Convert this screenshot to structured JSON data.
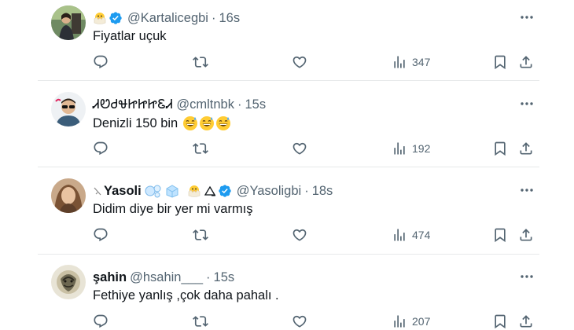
{
  "tweets": [
    {
      "name": "",
      "name_emojis": [
        "hatching-chick-icon"
      ],
      "handle": "@Kartalicegbi",
      "time": "16s",
      "verified": true,
      "text": "Fiyatlar uçuk",
      "text_emojis": [],
      "views": "347"
    },
    {
      "name": "ᏗᏬᏧᏠᏥᏥᏥᏋᏗ",
      "name_emojis": [],
      "handle": "@cmltnbk",
      "time": "15s",
      "verified": false,
      "text": "Denizli 150 bin",
      "text_emojis": [
        "grinning-sweat-icon",
        "grinning-sweat-icon",
        "grinning-sweat-icon"
      ],
      "views": "192"
    },
    {
      "name": "Yasoli",
      "name_emojis": [
        "bubbles-icon",
        "ice-cube-icon",
        "hatching-chick-icon",
        "triangle-icon"
      ],
      "handle": "@Yasoligbi",
      "time": "18s",
      "verified": true,
      "text": "Didim diye bir yer mi varmış",
      "text_emojis": [],
      "views": "474"
    },
    {
      "name": "şahin",
      "name_emojis": [],
      "handle": "@hsahin___",
      "time": "15s",
      "verified": false,
      "text": "Fethiye yanlış ,çok daha pahalı .",
      "text_emojis": [],
      "views": "207"
    }
  ],
  "separator": "·",
  "colors": {
    "text": "#0f1419",
    "secondary": "#536471",
    "verified": "#1d9bf0",
    "divider": "#e7e9ea"
  }
}
